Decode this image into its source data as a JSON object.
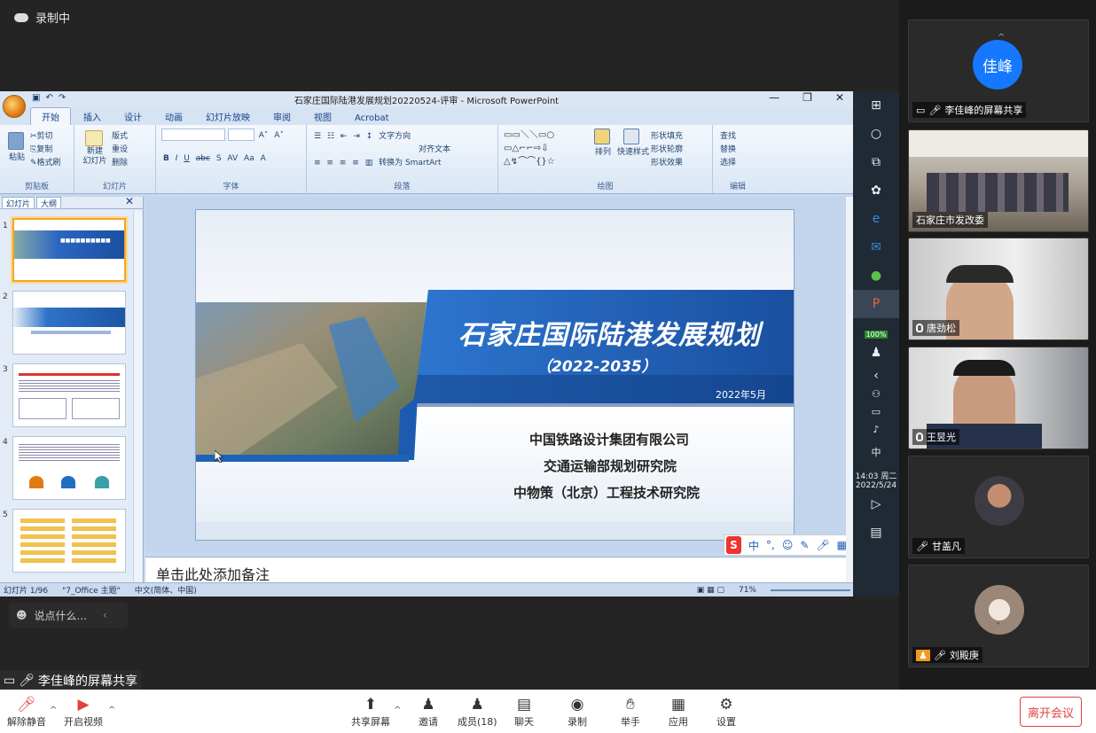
{
  "recording": {
    "label": "录制中"
  },
  "ppt": {
    "title": "石家庄国际陆港发展规划20220524-评审 - Microsoft PowerPoint",
    "tabs": [
      "开始",
      "插入",
      "设计",
      "动画",
      "幻灯片放映",
      "审阅",
      "视图",
      "Acrobat"
    ],
    "ribbon": {
      "clipboard": {
        "paste": "粘贴",
        "cut": "剪切",
        "copy": "复制",
        "format_painter": "格式刷",
        "name": "剪贴板"
      },
      "slides": {
        "new_slide": "新建\n幻灯片",
        "layout": "版式",
        "reset": "重设",
        "delete": "删除",
        "name": "幻灯片"
      },
      "font": {
        "name": "字体"
      },
      "paragraph": {
        "text_direction": "文字方向",
        "align_text": "对齐文本",
        "smartart": "转换为 SmartArt",
        "name": "段落"
      },
      "drawing": {
        "arrange": "排列",
        "quick_styles": "快速样式",
        "shape_fill": "形状填充",
        "shape_outline": "形状轮廓",
        "shape_effects": "形状效果",
        "name": "绘图"
      },
      "editing": {
        "find": "查找",
        "replace": "替换",
        "select": "选择",
        "name": "编辑"
      }
    },
    "pane_tabs": [
      "幻灯片",
      "大纲"
    ],
    "slide_numbers": [
      "1",
      "2",
      "3",
      "4",
      "5"
    ],
    "slide": {
      "title": "石家庄国际陆港发展规划",
      "years": "（2022-2035）",
      "date": "2022年5月",
      "orgs": [
        "中国铁路设计集团有限公司",
        "交通运输部规划研究院",
        "中物策（北京）工程技术研究院"
      ]
    },
    "notes_placeholder": "单击此处添加备注",
    "status": {
      "slide_pos": "幻灯片 1/96",
      "theme": "\"7_Office 主题\"",
      "lang": "中文(简体、中国)",
      "zoom": "71%"
    },
    "ime": {
      "label": "中"
    }
  },
  "taskbar": {
    "battery": "100%",
    "ime": "中",
    "time": "14:03 周二",
    "date": "2022/5/24"
  },
  "chat": {
    "placeholder": "说点什么..."
  },
  "share_tag": {
    "label": "李佳峰的屏幕共享"
  },
  "participants": [
    {
      "avatar_text": "佳峰",
      "name": "李佳峰的屏幕共享"
    },
    {
      "name": "石家庄市发改委"
    },
    {
      "name": "唐劲松"
    },
    {
      "name": "王昱光"
    },
    {
      "name": "甘盖凡"
    },
    {
      "name": "刘殿庚"
    }
  ],
  "bottom": {
    "unmute": "解除静音",
    "start_video": "开启视频",
    "share": "共享屏幕",
    "invite": "邀请",
    "members": "成员(18)",
    "chat": "聊天",
    "record": "录制",
    "raise_hand": "举手",
    "apps": "应用",
    "settings": "设置",
    "leave": "离开会议"
  },
  "colors": {
    "accent_blue": "#1677ff",
    "leave_red": "#e0433a",
    "slide_blue": "#1e63b8"
  }
}
